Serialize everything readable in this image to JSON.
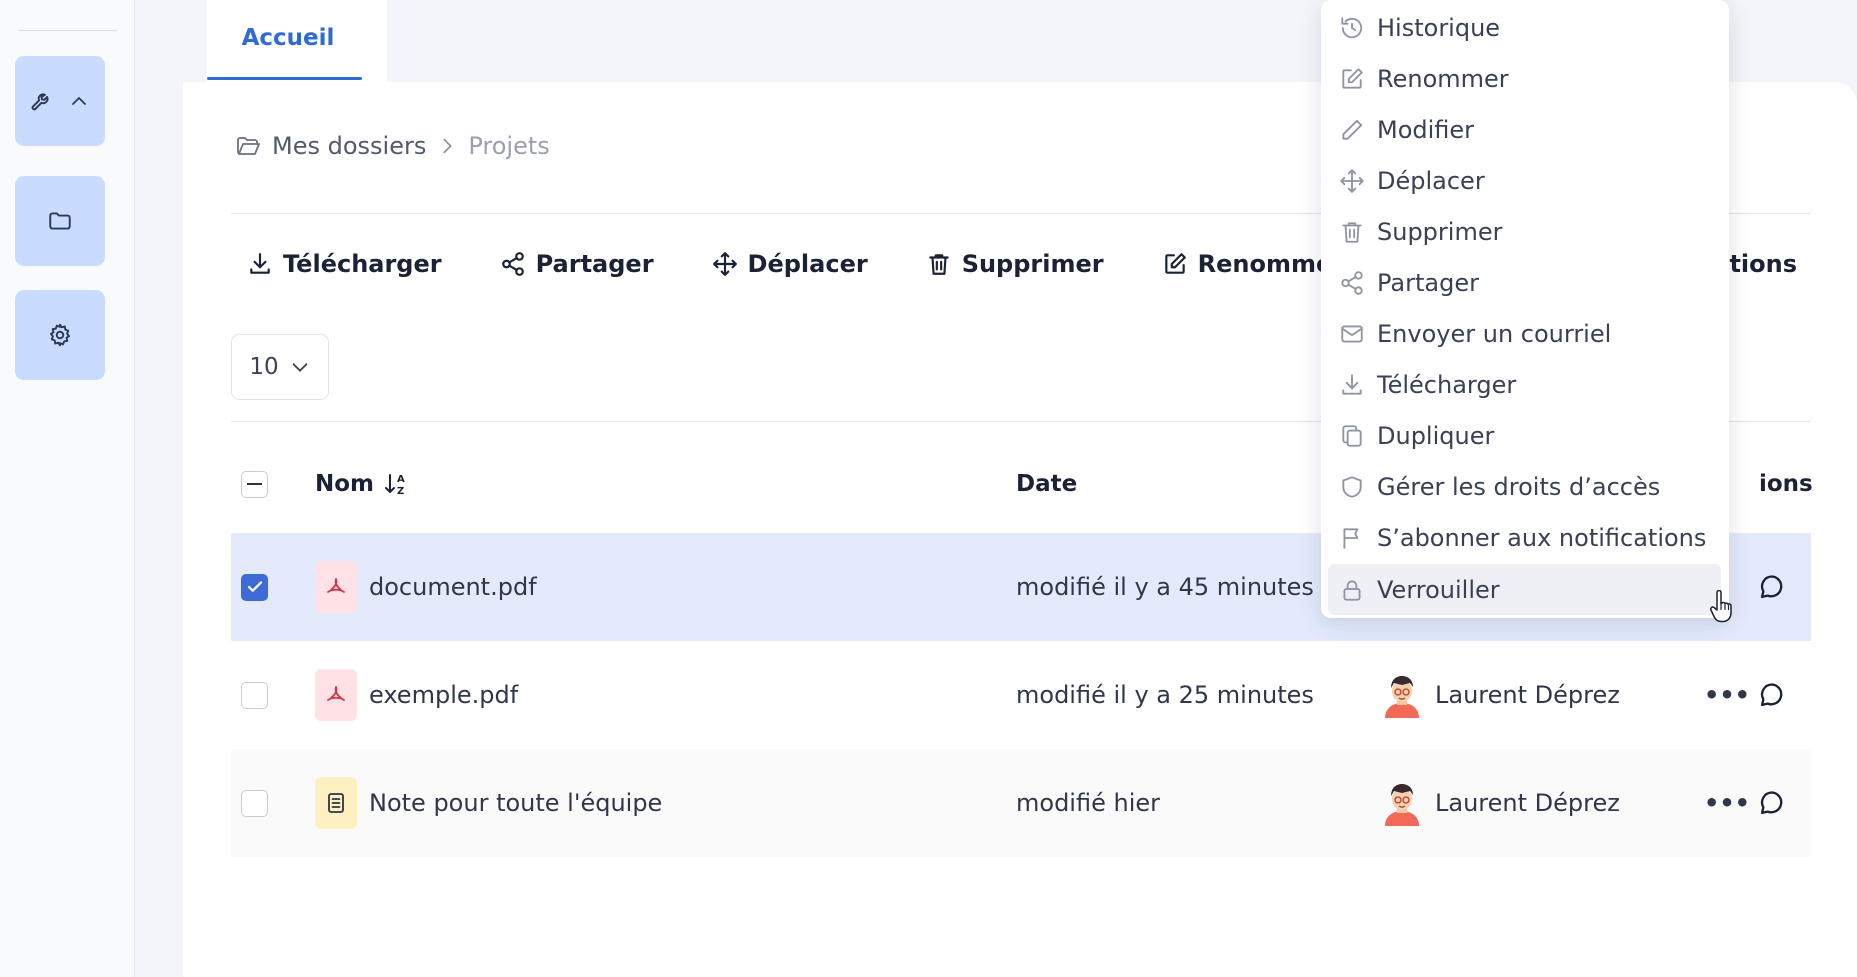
{
  "tabs": [
    {
      "label": "Accueil",
      "active": true
    }
  ],
  "breadcrumb": {
    "root": "Mes dossiers",
    "current": "Projets"
  },
  "toolbar": {
    "download": "Télécharger",
    "share": "Partager",
    "move": "Déplacer",
    "delete": "Supprimer",
    "rename": "Renommer",
    "more_partial": "tions"
  },
  "pager": {
    "page_size": "10"
  },
  "table": {
    "headers": {
      "name": "Nom",
      "date": "Date",
      "actions_partial": "ions"
    },
    "rows": [
      {
        "name": "document.pdf",
        "type": "pdf",
        "date": "modifié il y a 45 minutes",
        "owner": "",
        "selected": true
      },
      {
        "name": "exemple.pdf",
        "type": "pdf",
        "date": "modifié il y a 25 minutes",
        "owner": "Laurent Déprez",
        "selected": false
      },
      {
        "name": "Note pour toute l'équipe",
        "type": "note",
        "date": "modifié hier",
        "owner": "Laurent Déprez",
        "selected": false
      }
    ]
  },
  "context_menu": {
    "items": [
      {
        "label": "Historique",
        "icon": "history-icon"
      },
      {
        "label": "Renommer",
        "icon": "rename-icon"
      },
      {
        "label": "Modifier",
        "icon": "pencil-icon"
      },
      {
        "label": "Déplacer",
        "icon": "move-icon"
      },
      {
        "label": "Supprimer",
        "icon": "trash-icon"
      },
      {
        "label": "Partager",
        "icon": "share-icon"
      },
      {
        "label": "Envoyer un courriel",
        "icon": "mail-icon"
      },
      {
        "label": "Télécharger",
        "icon": "download-icon"
      },
      {
        "label": "Dupliquer",
        "icon": "duplicate-icon"
      },
      {
        "label": "Gérer les droits d’accès",
        "icon": "shield-icon"
      },
      {
        "label": "S’abonner aux notifications",
        "icon": "flag-icon"
      },
      {
        "label": "Verrouiller",
        "icon": "lock-icon",
        "hovered": true
      }
    ]
  },
  "colors": {
    "accent": "#2f6bd8",
    "selected_row": "#e3eafc",
    "rail_button": "#c9dcff",
    "pdf_tint": "#ffe1e6",
    "note_tint": "#fff0c2"
  }
}
